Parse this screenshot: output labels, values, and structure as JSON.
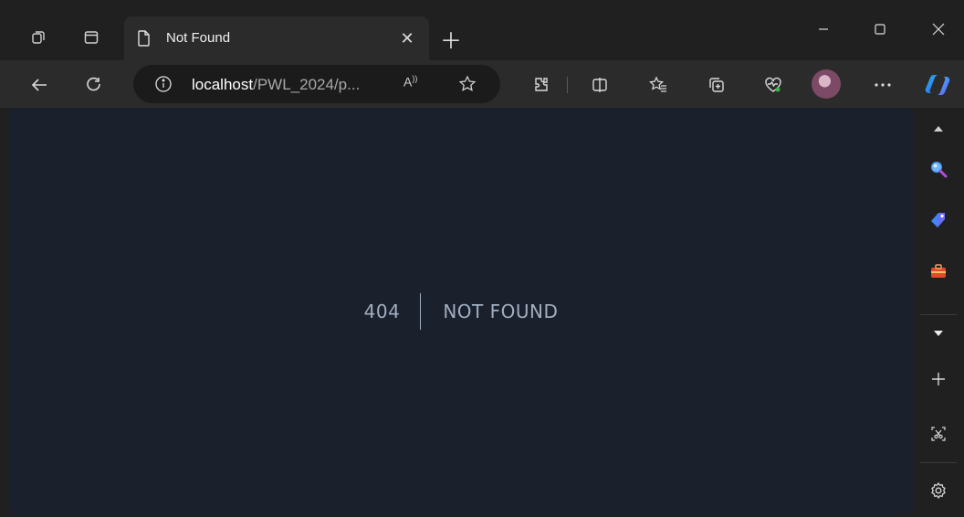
{
  "tab": {
    "title": "Not Found"
  },
  "address": {
    "host": "localhost",
    "path": "/PWL_2024/p..."
  },
  "page": {
    "code": "404",
    "message": "NOT FOUND"
  },
  "colors": {
    "page_bg": "#1a202c",
    "page_text": "#a0aec0",
    "chrome_bg": "#202020",
    "toolbar_bg": "#2b2b2b"
  }
}
